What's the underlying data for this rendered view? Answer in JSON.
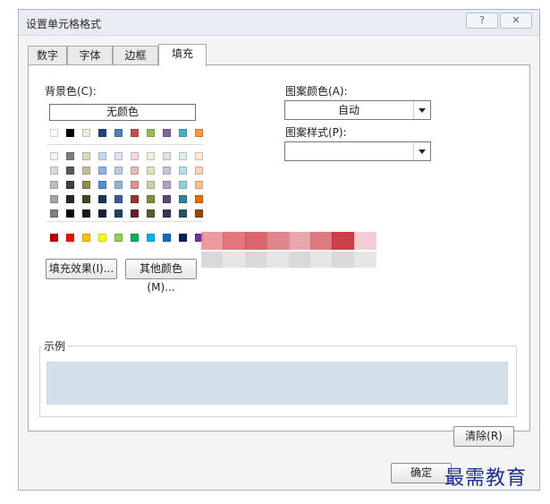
{
  "window": {
    "title": "设置单元格格式",
    "help_glyph": "?",
    "close_glyph": "✕"
  },
  "tabs": [
    {
      "label": "数字",
      "active": false
    },
    {
      "label": "字体",
      "active": false
    },
    {
      "label": "边框",
      "active": false
    },
    {
      "label": "填充",
      "active": true
    }
  ],
  "background_color": {
    "label": "背景色(C):",
    "no_color_label": "无颜色",
    "selected_color": "#dce6f1",
    "standard_row": [
      "#ffffff",
      "#000000",
      "#eeece1",
      "#1f497d",
      "#4f81bd",
      "#c0504d",
      "#9bbb59",
      "#8064a2",
      "#4bacc6",
      "#f79646"
    ],
    "theme_rows": [
      [
        "#f2f2f2",
        "#7f7f7f",
        "#ddd9c3",
        "#c6d9f0",
        "#dbe5f1",
        "#f2dcdb",
        "#ebf1dd",
        "#e5e0ec",
        "#dbeef3",
        "#fdeada"
      ],
      [
        "#d8d8d8",
        "#595959",
        "#c4bd97",
        "#8db3e2",
        "#b8cce4",
        "#e5b9b7",
        "#d7e3bc",
        "#ccc1d9",
        "#b7dde8",
        "#fbd5b5"
      ],
      [
        "#bfbfbf",
        "#3f3f3f",
        "#938953",
        "#548dd4",
        "#95b3d7",
        "#d99694",
        "#c3d69b",
        "#b2a2c7",
        "#92cddc",
        "#fac08f"
      ],
      [
        "#a5a5a5",
        "#262626",
        "#494429",
        "#17365d",
        "#366092",
        "#953734",
        "#76923c",
        "#5f497a",
        "#31859b",
        "#e36c09"
      ],
      [
        "#7f7f7f",
        "#0c0c0c",
        "#1d1b10",
        "#0f243e",
        "#244061",
        "#632423",
        "#4f6128",
        "#3f3151",
        "#205867",
        "#974806"
      ]
    ],
    "bright_row": [
      "#c00000",
      "#ff0000",
      "#ffc000",
      "#ffff00",
      "#92d050",
      "#00b050",
      "#00b0f0",
      "#0070c0",
      "#002060",
      "#7030a0"
    ]
  },
  "buttons": {
    "fill_effects": "填充效果(I)...",
    "more_colors": "其他颜色(M)...",
    "clear": "清除(R)",
    "ok": "确定"
  },
  "pattern": {
    "color_label": "图案颜色(A):",
    "color_value": "自动",
    "style_label": "图案样式(P):",
    "style_value": ""
  },
  "sample": {
    "label": "示例",
    "color": "#d3dfeb"
  },
  "watermark": "最需教育",
  "blur_colors": [
    "#e8898f",
    "#dd5f68",
    "#d64b55",
    "#d9707a",
    "#e39aa0",
    "#d8636b",
    "#c41e2a",
    "#f2c6c9"
  ]
}
